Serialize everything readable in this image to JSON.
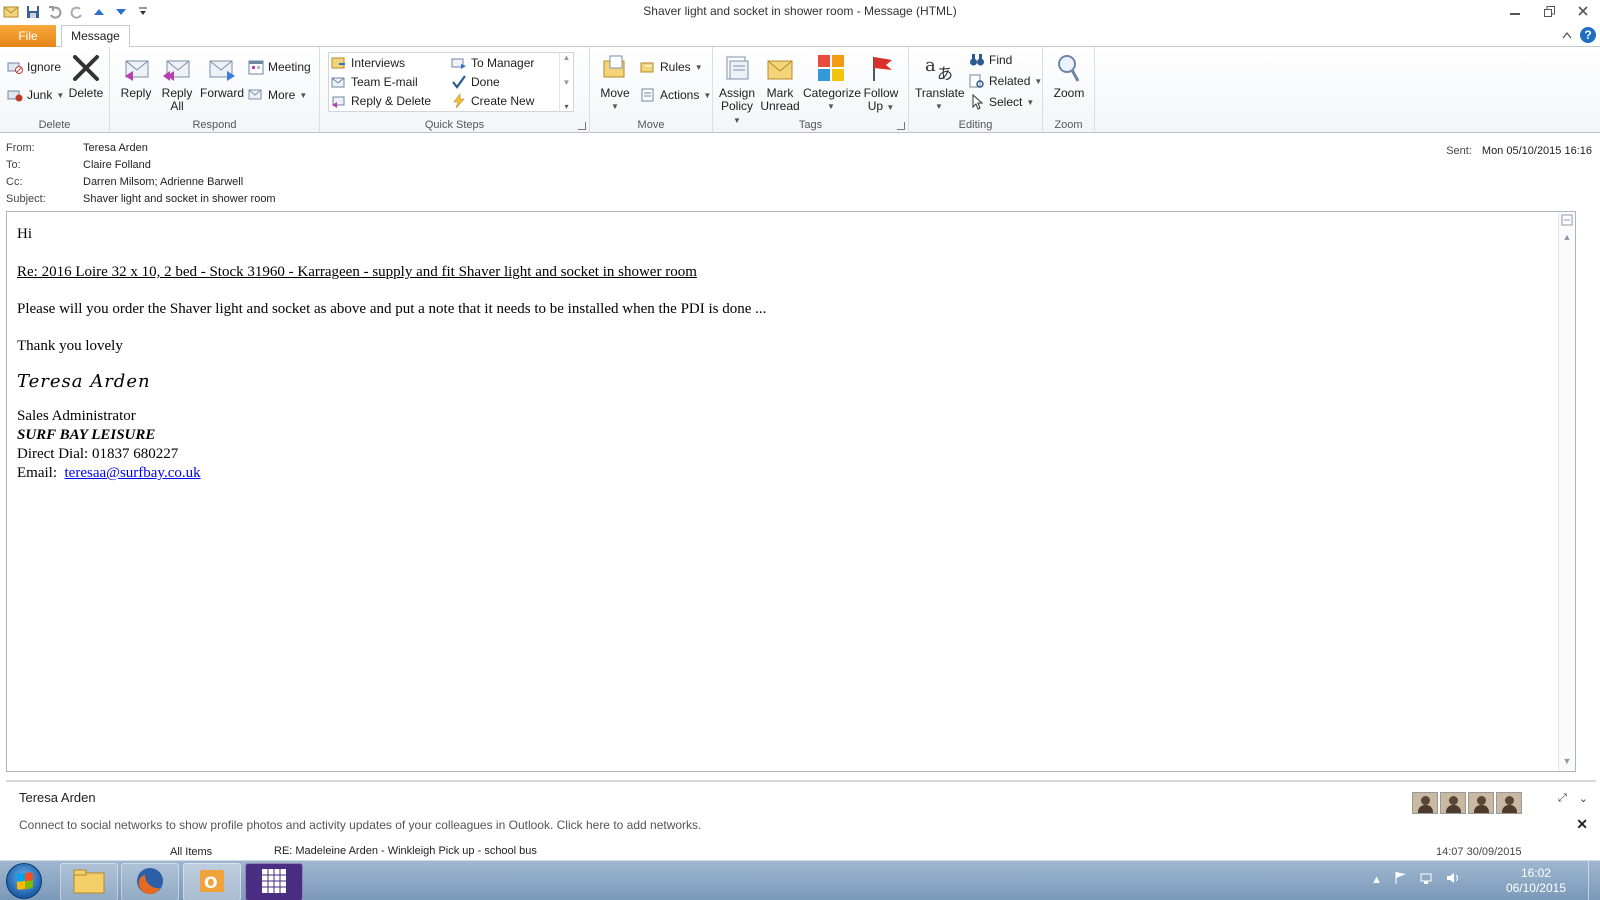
{
  "window": {
    "title": "Shaver light and socket in shower room  -  Message (HTML)"
  },
  "tabs": {
    "file": "File",
    "message": "Message"
  },
  "ribbon": {
    "delete": {
      "ignore": "Ignore",
      "junk": "Junk",
      "delete": "Delete",
      "label": "Delete"
    },
    "respond": {
      "reply": "Reply",
      "reply_all_1": "Reply",
      "reply_all_2": "All",
      "forward": "Forward",
      "meeting": "Meeting",
      "more": "More",
      "label": "Respond"
    },
    "quick_steps": {
      "items": [
        "Interviews",
        "To Manager",
        "Team E-mail",
        "Done",
        "Reply & Delete",
        "Create New"
      ],
      "label": "Quick Steps"
    },
    "move": {
      "move": "Move",
      "rules": "Rules",
      "actions": "Actions",
      "label": "Move"
    },
    "tags": {
      "assign_1": "Assign",
      "assign_2": "Policy",
      "mark_1": "Mark",
      "mark_2": "Unread",
      "categorize": "Categorize",
      "follow_1": "Follow",
      "follow_2": "Up",
      "label": "Tags"
    },
    "editing": {
      "translate": "Translate",
      "find": "Find",
      "related": "Related",
      "select": "Select",
      "label": "Editing"
    },
    "zoom": {
      "zoom": "Zoom",
      "label": "Zoom"
    }
  },
  "header": {
    "from_label": "From:",
    "from": "Teresa Arden",
    "to_label": "To:",
    "to": "Claire Folland",
    "cc_label": "Cc:",
    "cc": "Darren Milsom; Adrienne Barwell",
    "subject_label": "Subject:",
    "subject": "Shaver light and socket in shower room",
    "sent_label": "Sent:",
    "sent": "Mon 05/10/2015 16:16"
  },
  "body": {
    "greeting": "Hi",
    "reference": "Re: 2016 Loire 32 x 10, 2 bed - Stock 31960 - Karrageen - supply and fit Shaver light and socket in shower room",
    "message": "Please will you order the Shaver light and socket as above and put a note that it needs to be installed when the PDI is done ...",
    "thanks": "Thank you lovely",
    "signature": "Teresa Arden",
    "role": "Sales Administrator",
    "company": "SURF BAY LEISURE",
    "direct_dial": "Direct Dial:  01837 680227",
    "email_label": "Email:  ",
    "email": "teresaa@surfbay.co.uk"
  },
  "people_pane": {
    "name": "Teresa Arden",
    "info": "Connect to social networks to show profile photos and activity updates of your colleagues in Outlook. Click here to add networks."
  },
  "strip": {
    "all_items": "All Items",
    "message_subject": "RE: Madeleine Arden - Winkleigh Pick up - school bus",
    "date": "14:07  30/09/2015"
  },
  "taskbar": {
    "time": "16:02",
    "date": "06/10/2015"
  },
  "colors": {
    "file_tab": "#e5861a",
    "link": "#0000ee",
    "taskbar": "#7b99b8"
  }
}
